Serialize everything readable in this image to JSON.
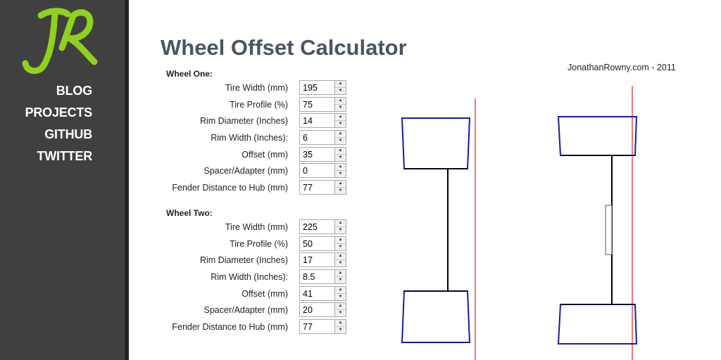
{
  "logo": {
    "text": "JR"
  },
  "nav": {
    "items": [
      {
        "label": "BLOG"
      },
      {
        "label": "PROJECTS"
      },
      {
        "label": "GITHUB"
      },
      {
        "label": "TWITTER"
      }
    ]
  },
  "page": {
    "title": "Wheel Offset Calculator",
    "credit": "JonathanRowny.com - 2011"
  },
  "wheel_one": {
    "title": "Wheel One:",
    "fields": [
      {
        "label": "Tire Width (mm)",
        "value": "195"
      },
      {
        "label": "Tire Profile (%)",
        "value": "75"
      },
      {
        "label": "Rim Diameter (Inches)",
        "value": "14"
      },
      {
        "label": "Rim Width (Inches):",
        "value": "6"
      },
      {
        "label": "Offset (mm)",
        "value": "35"
      },
      {
        "label": "Spacer/Adapter (mm)",
        "value": "0"
      },
      {
        "label": "Fender Distance to Hub (mm)",
        "value": "77"
      }
    ]
  },
  "wheel_two": {
    "title": "Wheel Two:",
    "fields": [
      {
        "label": "Tire Width (mm)",
        "value": "225"
      },
      {
        "label": "Tire Profile (%)",
        "value": "50"
      },
      {
        "label": "Rim Diameter (Inches)",
        "value": "17"
      },
      {
        "label": "Rim Width (Inches):",
        "value": "8.5"
      },
      {
        "label": "Offset (mm)",
        "value": "41"
      },
      {
        "label": "Spacer/Adapter (mm)",
        "value": "20"
      },
      {
        "label": "Fender Distance to Hub (mm)",
        "value": "77"
      }
    ]
  },
  "colors": {
    "sidebar": "#404040",
    "logo": "#8fd11f",
    "title": "#4a5563",
    "tire_outline": "#1a1aa6",
    "fender_line": "#e05050",
    "axle": "#000000",
    "spacer": "#555555"
  },
  "icons": {
    "spin_up": "▲",
    "spin_down": "▼"
  }
}
